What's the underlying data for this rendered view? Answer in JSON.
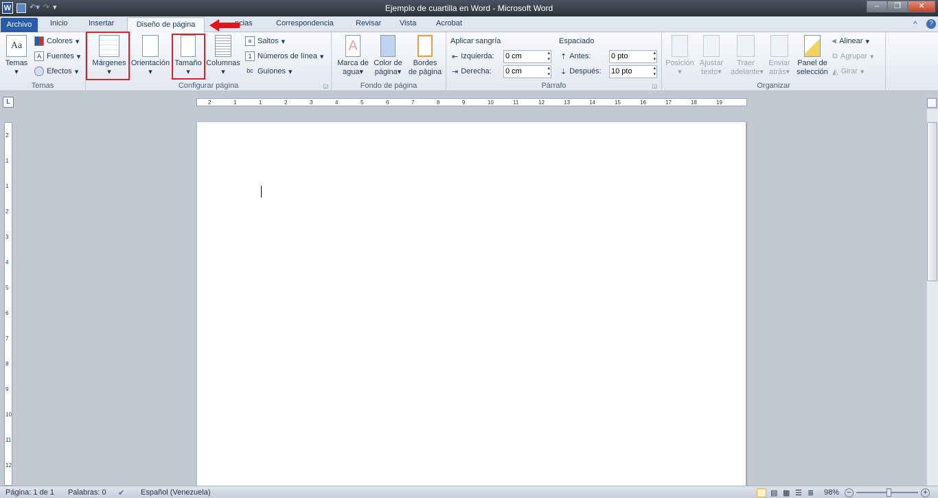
{
  "window": {
    "title": "Ejemplo de cuartilla en Word  -  Microsoft Word",
    "min": "–",
    "max": "❐",
    "close": "✕"
  },
  "tabs": {
    "file": "Archivo",
    "items": [
      "Inicio",
      "Insertar",
      "Diseño de página",
      "ncias",
      "Correspondencia",
      "Revisar",
      "Vista",
      "Acrobat"
    ],
    "help": "?",
    "collapse": "^"
  },
  "ribbon": {
    "temas": {
      "label": "Temas",
      "temas": "Temas",
      "colores": "Colores",
      "fuentes": "Fuentes",
      "efectos": "Efectos"
    },
    "config": {
      "label": "Configurar página",
      "margenes": "Márgenes",
      "orientacion": "Orientación",
      "tamano": "Tamaño",
      "columnas": "Columnas",
      "saltos": "Saltos",
      "numeros": "Números de línea",
      "guiones": "Guiones"
    },
    "fondo": {
      "label": "Fondo de página",
      "marca1": "Marca de",
      "marca2": "agua",
      "color1": "Color de",
      "color2": "página",
      "bordes1": "Bordes",
      "bordes2": "de página"
    },
    "parrafo": {
      "label": "Párrafo",
      "sangria": "Aplicar sangría",
      "izquierda": "Izquierda:",
      "izq_val": "0 cm",
      "derecha": "Derecha:",
      "der_val": "0 cm",
      "espaciado": "Espaciado",
      "antes": "Antes:",
      "antes_val": "0 pto",
      "despues": "Después:",
      "despues_val": "10 pto"
    },
    "organizar": {
      "label": "Organizar",
      "posicion": "Posición",
      "ajustar1": "Ajustar",
      "ajustar2": "texto",
      "traer1": "Traer",
      "traer2": "adelante",
      "enviar1": "Enviar",
      "enviar2": "atrás",
      "panel1": "Panel de",
      "panel2": "selección",
      "alinear": "Alinear",
      "agrupar": "Agrupar",
      "girar": "Girar"
    }
  },
  "ruler": {
    "marks": [
      "2",
      "1",
      "1",
      "2",
      "3",
      "4",
      "5",
      "6",
      "7",
      "8",
      "9",
      "10",
      "11",
      "12",
      "13",
      "14",
      "15",
      "16",
      "17",
      "18",
      "19"
    ],
    "vmarks": [
      "2",
      "1",
      "1",
      "2",
      "3",
      "4",
      "5",
      "6",
      "7",
      "8",
      "9",
      "10",
      "11",
      "12"
    ]
  },
  "status": {
    "pagina": "Página: 1 de 1",
    "palabras": "Palabras: 0",
    "idioma": "Español (Venezuela)",
    "zoom": "98%"
  }
}
